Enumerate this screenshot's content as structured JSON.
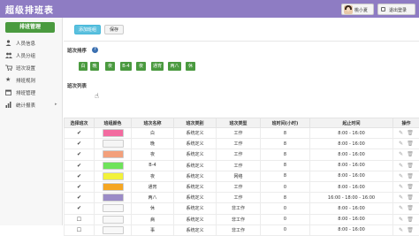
{
  "app": {
    "title": "超级排班表"
  },
  "user": {
    "name": "桃小夏",
    "logout": "退出登录"
  },
  "sidebar": {
    "header": "排班管理",
    "items": [
      {
        "label": "人员信息",
        "icon": "user-icon"
      },
      {
        "label": "人员分组",
        "icon": "users-icon"
      },
      {
        "label": "班次设置",
        "icon": "cart-icon"
      },
      {
        "label": "排班规则",
        "icon": "star-icon"
      },
      {
        "label": "排班管理",
        "icon": "calendar-icon"
      },
      {
        "label": "统计报表",
        "icon": "chart-icon",
        "chevron": "▸"
      }
    ]
  },
  "toolbar": {
    "add_label": "添加班组",
    "save_label": "保存"
  },
  "order_section": {
    "title": "班次排序",
    "chips": [
      "白",
      "晚",
      "夜",
      "B-4",
      "夜",
      "通宵",
      "两八",
      "休"
    ]
  },
  "list_section": {
    "title": "班次列表"
  },
  "table": {
    "headers": [
      "选择班次",
      "班组颜色",
      "班次名称",
      "班次类别",
      "班次类型",
      "班时间(小时)",
      "起止时间",
      "操作"
    ],
    "rows": [
      {
        "checked": "✔",
        "color": "#f36ba0",
        "name": "白",
        "category": "系统定义",
        "type": "工作",
        "hours": "8",
        "time": "8:00 - 16:00"
      },
      {
        "checked": "✔",
        "color": "#f5f5f5",
        "name": "晚",
        "category": "系统定义",
        "type": "工作",
        "hours": "8",
        "time": "8:00 - 16:00"
      },
      {
        "checked": "✔",
        "color": "#f3a07b",
        "name": "夜",
        "category": "系统定义",
        "type": "工作",
        "hours": "8",
        "time": "8:00 - 16:00"
      },
      {
        "checked": "✔",
        "color": "#6fe35b",
        "name": "B-4",
        "category": "系统定义",
        "type": "工作",
        "hours": "8",
        "time": "8:00 - 16:00"
      },
      {
        "checked": "✔",
        "color": "#f2f23a",
        "name": "夜",
        "category": "系统定义",
        "type": "网络",
        "hours": "8",
        "time": "8:00 - 16:00"
      },
      {
        "checked": "✔",
        "color": "#f5a623",
        "name": "通宵",
        "category": "系统定义",
        "type": "工作",
        "hours": "0",
        "time": "8:00 - 16:00"
      },
      {
        "checked": "✔",
        "color": "#9b8cc7",
        "name": "两八",
        "category": "系统定义",
        "type": "工作",
        "hours": "8",
        "time": "16:00 - 18:00 - 16:00"
      },
      {
        "checked": "✔",
        "color": "#f8f8f8",
        "name": "休",
        "category": "系统定义",
        "type": "非工作",
        "hours": "0",
        "time": "8:00 - 16:00"
      },
      {
        "checked": "☐",
        "color": "#f8f8f8",
        "name": "病",
        "category": "系统定义",
        "type": "非工作",
        "hours": "0",
        "time": "8:00 - 16:00"
      },
      {
        "checked": "☐",
        "color": "#f8f8f8",
        "name": "事",
        "category": "系统定义",
        "type": "非工作",
        "hours": "0",
        "time": "8:00 - 16:00"
      }
    ],
    "edit_icon": "✎",
    "delete_icon": "🗑"
  }
}
